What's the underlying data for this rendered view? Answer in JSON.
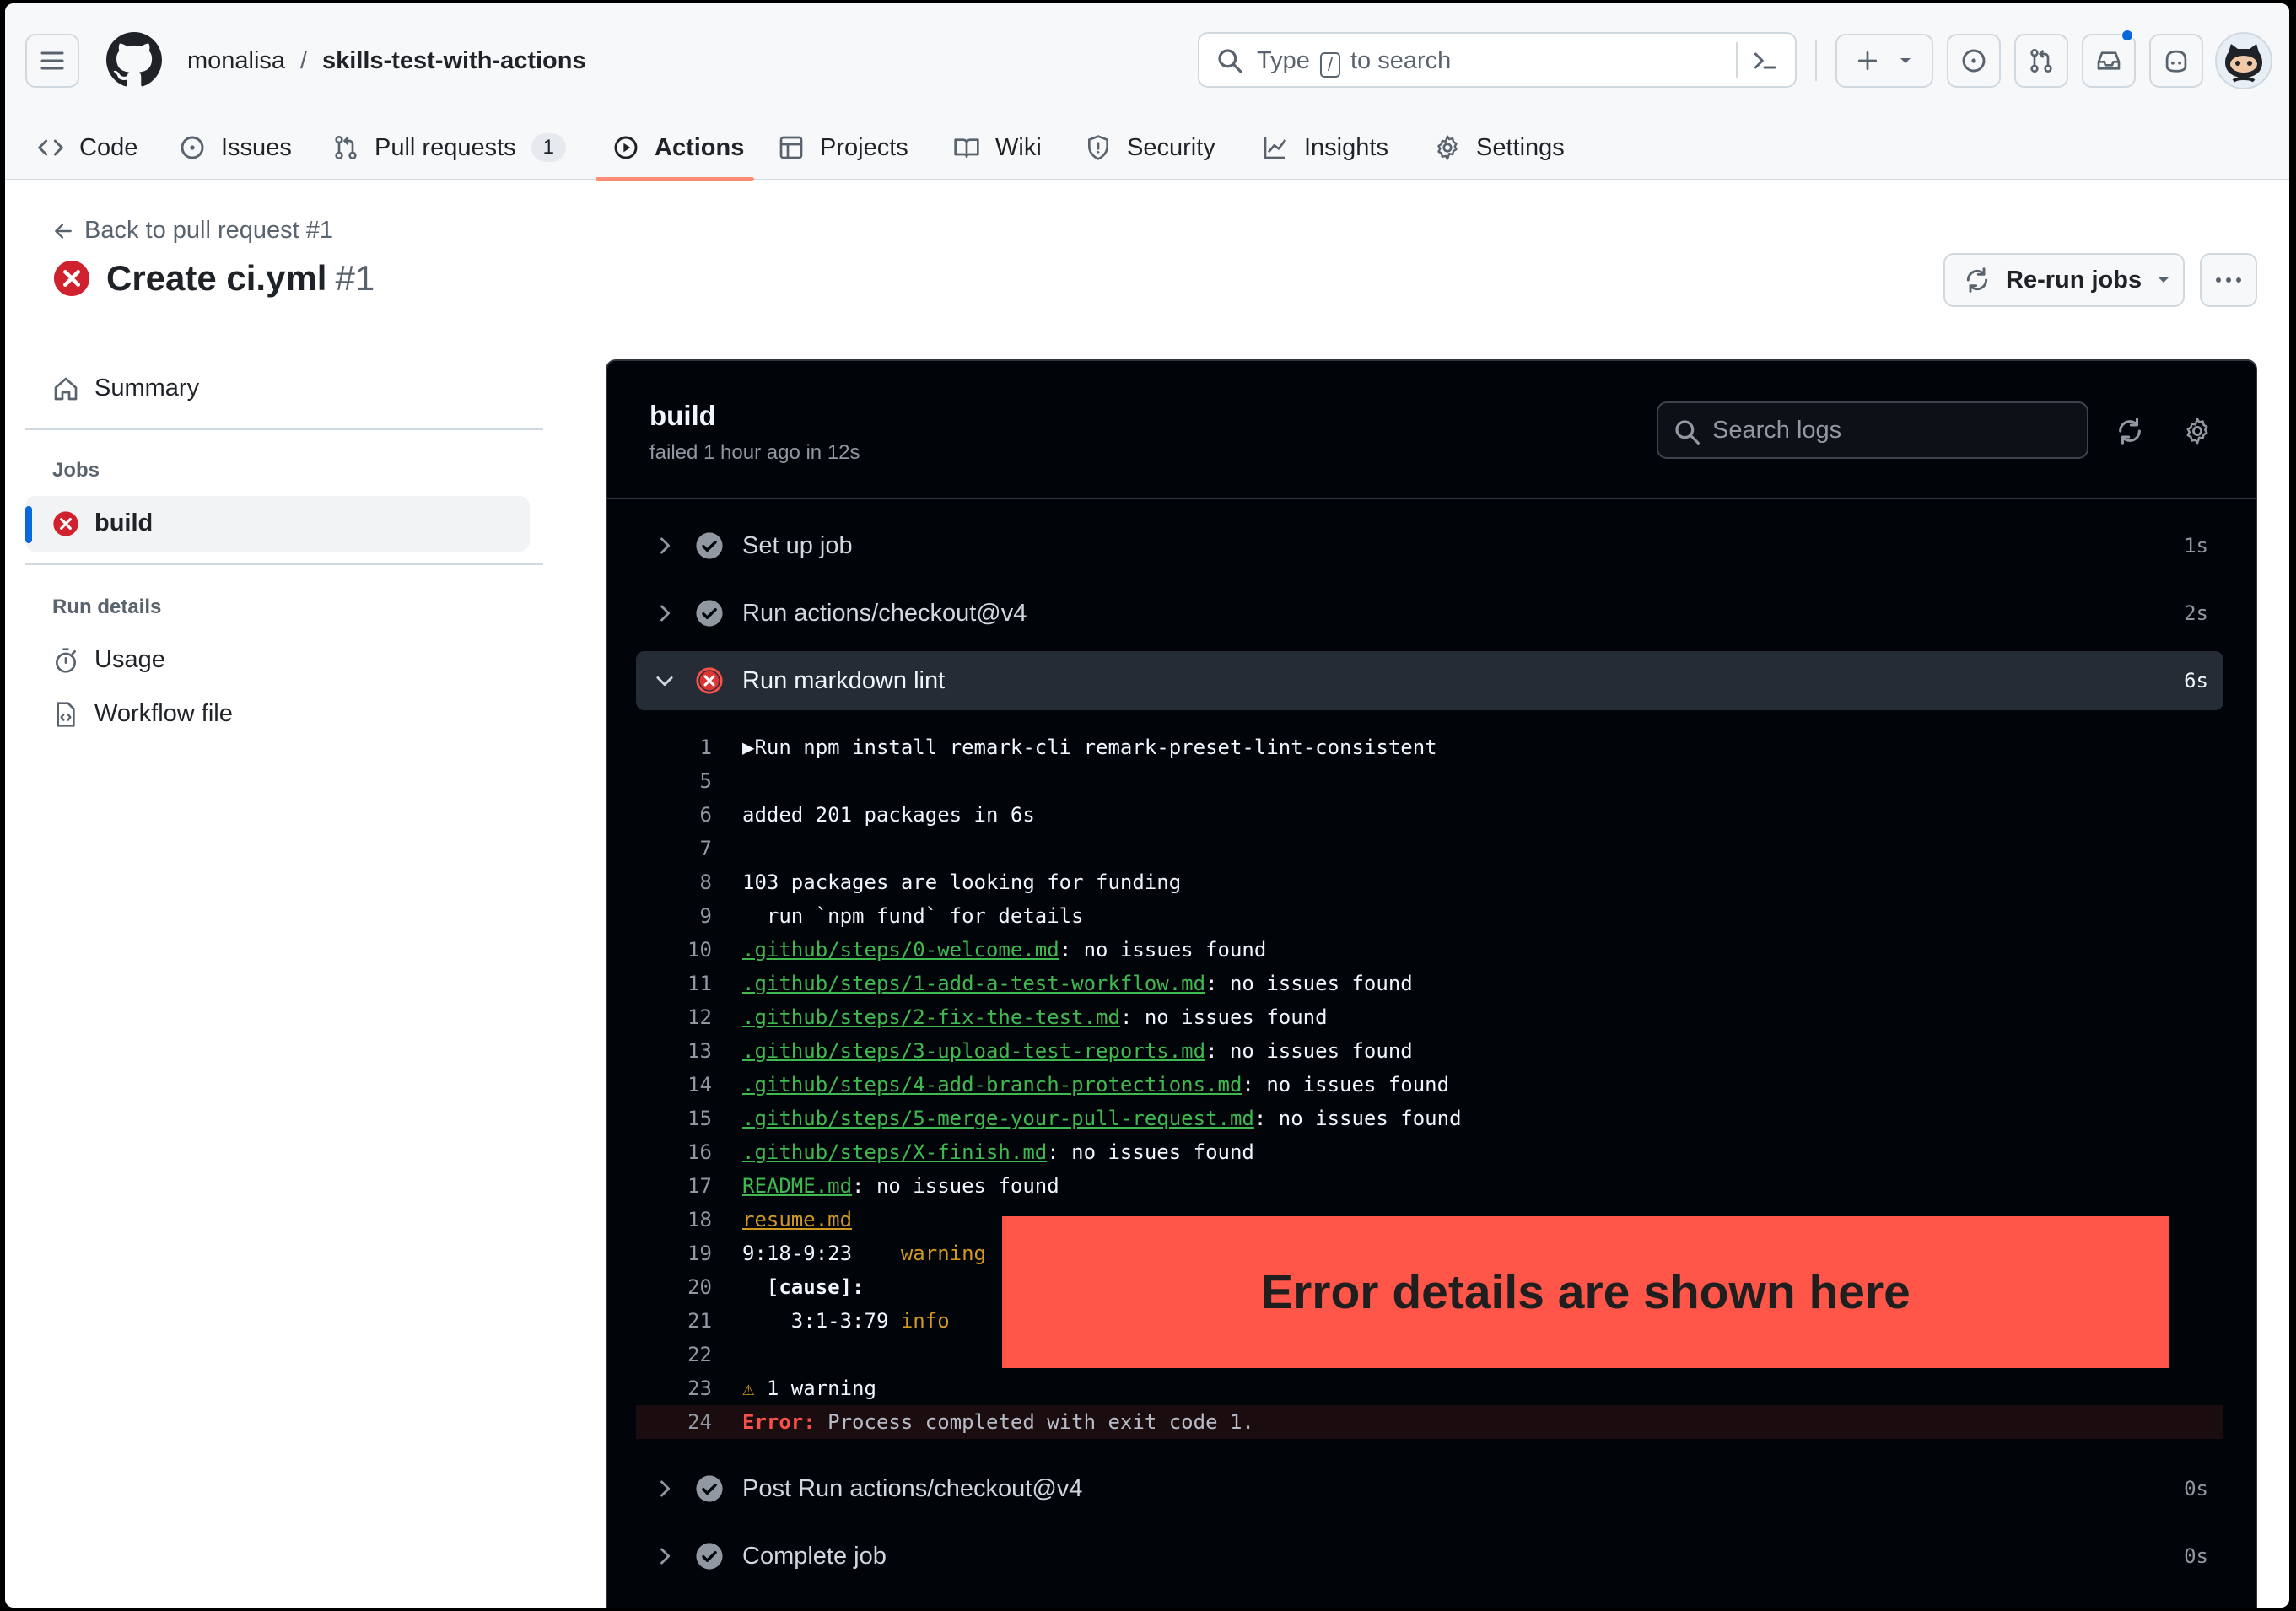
{
  "repo": {
    "owner": "monalisa",
    "separator": "/",
    "name": "skills-test-with-actions"
  },
  "search": {
    "prefix": "Type",
    "key": "/",
    "suffix": "to search"
  },
  "tabs": [
    {
      "label": "Code",
      "icon": "code-icon"
    },
    {
      "label": "Issues",
      "icon": "issue-icon"
    },
    {
      "label": "Pull requests",
      "icon": "pull-request-icon",
      "count": "1"
    },
    {
      "label": "Actions",
      "icon": "play-icon",
      "active": true
    },
    {
      "label": "Projects",
      "icon": "table-icon"
    },
    {
      "label": "Wiki",
      "icon": "book-icon"
    },
    {
      "label": "Security",
      "icon": "shield-icon"
    },
    {
      "label": "Insights",
      "icon": "graph-icon"
    },
    {
      "label": "Settings",
      "icon": "gear-icon"
    }
  ],
  "page": {
    "back": "Back to pull request #1",
    "title": "Create ci.yml",
    "number": "#1",
    "status": "failed"
  },
  "actions": {
    "rerun": "Re-run jobs"
  },
  "sidebar": {
    "summary": "Summary",
    "jobs_heading": "Jobs",
    "job": "build",
    "run_details_heading": "Run details",
    "usage": "Usage",
    "workflow_file": "Workflow file"
  },
  "log": {
    "job_title": "build",
    "job_subtitle": "failed 1 hour ago in 12s",
    "search_placeholder": "Search logs",
    "steps": [
      {
        "label": "Set up job",
        "duration": "1s",
        "status": "success"
      },
      {
        "label": "Run actions/checkout@v4",
        "duration": "2s",
        "status": "success"
      },
      {
        "label": "Run markdown lint",
        "duration": "6s",
        "status": "failure",
        "expanded": true
      },
      {
        "label": "Post Run actions/checkout@v4",
        "duration": "0s",
        "status": "success"
      },
      {
        "label": "Complete job",
        "duration": "0s",
        "status": "success"
      }
    ],
    "lines": [
      {
        "no": "1",
        "text": "Run npm install remark-cli remark-preset-lint-consistent",
        "prefix": "▶"
      },
      {
        "no": "5",
        "text": ""
      },
      {
        "no": "6",
        "text": "added 201 packages in 6s"
      },
      {
        "no": "7",
        "text": ""
      },
      {
        "no": "8",
        "text": "103 packages are looking for funding"
      },
      {
        "no": "9",
        "text": "  run `npm fund` for details"
      },
      {
        "no": "10",
        "link": ".github/steps/0-welcome.md",
        "text": ": no issues found"
      },
      {
        "no": "11",
        "link": ".github/steps/1-add-a-test-workflow.md",
        "text": ": no issues found"
      },
      {
        "no": "12",
        "link": ".github/steps/2-fix-the-test.md",
        "text": ": no issues found"
      },
      {
        "no": "13",
        "link": ".github/steps/3-upload-test-reports.md",
        "text": ": no issues found"
      },
      {
        "no": "14",
        "link": ".github/steps/4-add-branch-protections.md",
        "text": ": no issues found"
      },
      {
        "no": "15",
        "link": ".github/steps/5-merge-your-pull-request.md",
        "text": ": no issues found"
      },
      {
        "no": "16",
        "link": ".github/steps/X-finish.md",
        "text": ": no issues found"
      },
      {
        "no": "17",
        "link": "README.md",
        "text": ": no issues found"
      },
      {
        "no": "18",
        "link_warn": "resume.md",
        "text": ""
      },
      {
        "no": "19",
        "text": "9:18-9:23",
        "tag": "warning"
      },
      {
        "no": "20",
        "text": "  [cause]:"
      },
      {
        "no": "21",
        "text": "    3:1-3:79",
        "tag": "info"
      },
      {
        "no": "22",
        "text": ""
      },
      {
        "no": "23",
        "prefix": "⚠",
        "text": " 1 warning"
      },
      {
        "no": "24",
        "error_label": "Error:",
        "text": " Process completed with exit code 1."
      }
    ]
  },
  "annotation": "Error details are shown here",
  "colors": {
    "accent": "#0969da",
    "danger": "#cf222e",
    "success_dark": "#3fb950",
    "annotation": "#ff5649",
    "active_tab_underline": "#fd8c73"
  }
}
